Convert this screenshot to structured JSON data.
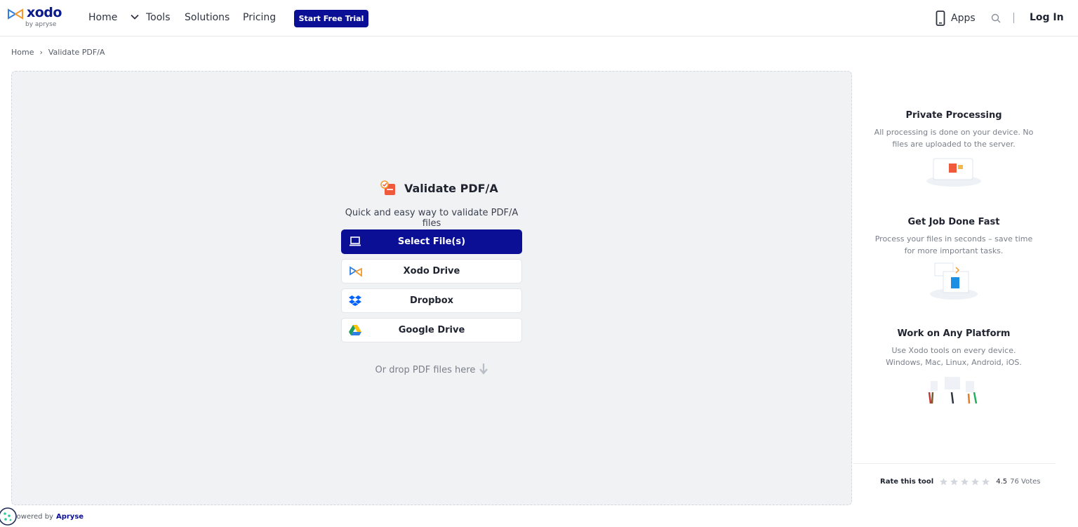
{
  "header": {
    "logo_word": "xodo",
    "logo_by": "by apryse",
    "nav": {
      "home": "Home",
      "tools": "Tools",
      "solutions": "Solutions",
      "pricing": "Pricing"
    },
    "trial_label": "Start Free Trial",
    "apps_label": "Apps",
    "login_label": "Log In"
  },
  "breadcrumb": {
    "home": "Home",
    "separator": "›",
    "current": "Validate PDF/A"
  },
  "tool": {
    "title": "Validate PDF/A",
    "subtitle": "Quick and easy way to validate PDF/A files",
    "buttons": [
      {
        "label": "Select File(s)",
        "icon": "laptop-icon"
      },
      {
        "label": "Xodo Drive",
        "icon": "xodo-drive-icon"
      },
      {
        "label": "Dropbox",
        "icon": "dropbox-icon"
      },
      {
        "label": "Google Drive",
        "icon": "google-drive-icon"
      }
    ],
    "drop_hint": "Or drop PDF files here"
  },
  "features": [
    {
      "title": "Private Processing",
      "desc": "All processing is done on your device. No files are uploaded to the server."
    },
    {
      "title": "Get Job Done Fast",
      "desc": "Process your files in seconds – save time for more important tasks."
    },
    {
      "title": "Work on Any Platform",
      "desc": "Use Xodo tools on every device. Windows, Mac, Linux, Android, iOS."
    }
  ],
  "rating": {
    "label": "Rate this tool",
    "score": "4.5",
    "votes": "76 Votes",
    "stars_total": 5
  },
  "footer": {
    "powered_by": "Powered by",
    "brand": "Apryse"
  },
  "colors": {
    "primary": "#0a0f96",
    "brand_dark": "#0b1a8c",
    "dropzone_bg": "#f1f2f4",
    "pdf_red": "#f05a3c"
  }
}
